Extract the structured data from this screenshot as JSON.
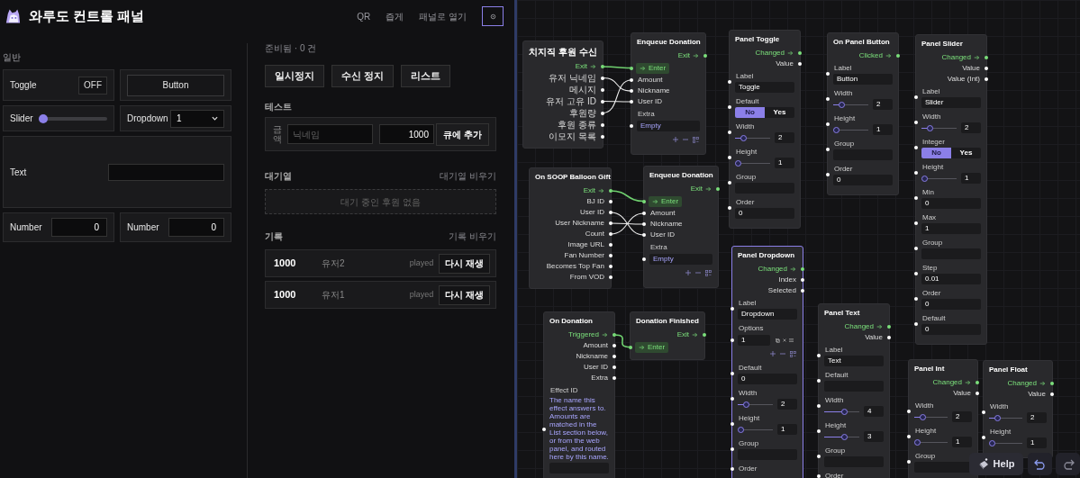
{
  "header": {
    "title": "와루도 컨트롤 패널",
    "links": [
      "QR",
      "즙게",
      "패널로 열기"
    ]
  },
  "panel": {
    "section": "일반",
    "widgets": [
      {
        "kind": "toggle",
        "label": "Toggle",
        "on": false,
        "state_text": "OFF"
      },
      {
        "kind": "button",
        "label": "Button"
      },
      {
        "kind": "slider",
        "label": "Slider",
        "level": 0
      },
      {
        "kind": "dropdown",
        "label": "Dropdown",
        "value": "1"
      },
      {
        "kind": "text",
        "label": "Text"
      },
      {
        "kind": "number",
        "label": "Number",
        "value": "0"
      },
      {
        "kind": "number",
        "label": "Number",
        "value": "0"
      }
    ]
  },
  "queue": {
    "status": "준비됨 · 0 건",
    "buttons": [
      "일시정지",
      "수신 정지",
      "리스트"
    ],
    "test": {
      "heading": "테스트",
      "amount_label": "금액",
      "nickname_placeholder": "닉네임",
      "amount": "1000",
      "add_button": "큐에 추가"
    },
    "waiting": {
      "heading": "대기열",
      "clear": "대기열 비우기",
      "empty": "대기 중인 후원 없음"
    },
    "history": {
      "heading": "기록",
      "clear": "기록 비우기",
      "rows": [
        {
          "amount": "1000",
          "user": "유저2",
          "status": "played",
          "replay": "다시 재생"
        },
        {
          "amount": "1000",
          "user": "유저1",
          "status": "played",
          "replay": "다시 재생"
        }
      ]
    }
  },
  "graph": {
    "nodes": [
      {
        "title": "치지직 후원 수신",
        "selected": false,
        "outputs": [
          {
            "label": "Exit",
            "kind": "flow"
          },
          {
            "label": "유저 닉네임",
            "kind": "data"
          },
          {
            "label": "메시지",
            "kind": "data"
          },
          {
            "label": "유저 고유 ID",
            "kind": "data"
          },
          {
            "label": "후원량",
            "kind": "data"
          },
          {
            "label": "후원 종류",
            "kind": "data"
          },
          {
            "label": "이모지 목록",
            "kind": "data"
          }
        ]
      },
      {
        "title": "Enqueue Donation",
        "selected": false,
        "outputs": [
          {
            "label": "Exit",
            "kind": "flow"
          }
        ],
        "inputs": [
          {
            "label": "Enter",
            "kind": "flow"
          },
          {
            "label": "Amount",
            "kind": "data"
          },
          {
            "label": "Nickname",
            "kind": "data"
          },
          {
            "label": "User ID",
            "kind": "data"
          }
        ],
        "fields": [
          {
            "kind": "list",
            "label": "Extra",
            "empty": "Empty"
          }
        ]
      },
      {
        "title": "Panel Toggle",
        "selected": false,
        "outputs": [
          {
            "label": "Changed",
            "kind": "flow"
          },
          {
            "label": "Value",
            "kind": "data"
          }
        ],
        "fields": [
          {
            "kind": "text",
            "label": "Label",
            "value": "Toggle"
          },
          {
            "kind": "choice",
            "label": "Default",
            "options": [
              {
                "label": "No",
                "selected": true
              },
              {
                "label": "Yes",
                "selected": false
              }
            ]
          },
          {
            "kind": "slider",
            "label": "Width",
            "level": 0.2,
            "value": "2"
          },
          {
            "kind": "slider",
            "label": "Height",
            "level": 0,
            "value": "1"
          },
          {
            "kind": "text",
            "label": "Group"
          },
          {
            "kind": "text",
            "label": "Order",
            "value": "0"
          }
        ]
      },
      {
        "title": "On Panel Button",
        "selected": false,
        "outputs": [
          {
            "label": "Clicked",
            "kind": "flow"
          }
        ],
        "fields": [
          {
            "kind": "text",
            "label": "Label",
            "value": "Button"
          },
          {
            "kind": "slider",
            "label": "Width",
            "level": 0.2,
            "value": "2"
          },
          {
            "kind": "slider",
            "label": "Height",
            "level": 0,
            "value": "1"
          },
          {
            "kind": "text",
            "label": "Group"
          },
          {
            "kind": "text",
            "label": "Order",
            "value": "0"
          }
        ]
      },
      {
        "title": "Panel Slider",
        "selected": false,
        "outputs": [
          {
            "label": "Changed",
            "kind": "flow"
          },
          {
            "label": "Value",
            "kind": "data"
          },
          {
            "label": "Value (Int)",
            "kind": "data"
          }
        ],
        "fields": [
          {
            "kind": "text",
            "label": "Label",
            "value": "Slider"
          },
          {
            "kind": "slider",
            "label": "Width",
            "level": 0.2,
            "value": "2"
          },
          {
            "kind": "choice",
            "label": "Integer",
            "options": [
              {
                "label": "No",
                "selected": true
              },
              {
                "label": "Yes",
                "selected": false
              }
            ]
          },
          {
            "kind": "slider",
            "label": "Height",
            "level": 0,
            "value": "1"
          },
          {
            "kind": "text",
            "label": "Min",
            "value": "0"
          },
          {
            "kind": "text",
            "label": "Max",
            "value": "1"
          },
          {
            "kind": "text",
            "label": "Group"
          },
          {
            "kind": "text",
            "label": "Step",
            "value": "0.01"
          },
          {
            "kind": "text",
            "label": "Order",
            "value": "0"
          },
          {
            "kind": "text",
            "label": "Default",
            "value": "0"
          }
        ]
      },
      {
        "title": "On SOOP Balloon Gift",
        "selected": false,
        "outputs": [
          {
            "label": "Exit",
            "kind": "flow"
          },
          {
            "label": "BJ ID",
            "kind": "data"
          },
          {
            "label": "User ID",
            "kind": "data"
          },
          {
            "label": "User Nickname",
            "kind": "data"
          },
          {
            "label": "Count",
            "kind": "data"
          },
          {
            "label": "Image URL",
            "kind": "data"
          },
          {
            "label": "Fan Number",
            "kind": "data"
          },
          {
            "label": "Becomes Top Fan",
            "kind": "data"
          },
          {
            "label": "From VOD",
            "kind": "data"
          }
        ]
      },
      {
        "title": "Enqueue Donation",
        "selected": false,
        "outputs": [
          {
            "label": "Exit",
            "kind": "flow"
          }
        ],
        "inputs": [
          {
            "label": "Enter",
            "kind": "flow"
          },
          {
            "label": "Amount",
            "kind": "data"
          },
          {
            "label": "Nickname",
            "kind": "data"
          },
          {
            "label": "User ID",
            "kind": "data"
          }
        ],
        "fields": [
          {
            "kind": "list",
            "label": "Extra",
            "empty": "Empty"
          }
        ]
      },
      {
        "title": "Panel Dropdown",
        "selected": true,
        "outputs": [
          {
            "label": "Changed",
            "kind": "flow"
          },
          {
            "label": "Index",
            "kind": "data"
          },
          {
            "label": "Selected",
            "kind": "data"
          }
        ],
        "fields": [
          {
            "kind": "text",
            "label": "Label",
            "value": "Dropdown"
          },
          {
            "kind": "list",
            "label": "Options",
            "items": [
              "1"
            ]
          },
          {
            "kind": "text",
            "label": "Default",
            "value": "0"
          },
          {
            "kind": "slider",
            "label": "Width",
            "level": 0.2,
            "value": "2"
          },
          {
            "kind": "slider",
            "label": "Height",
            "level": 0,
            "value": "1"
          },
          {
            "kind": "text",
            "label": "Group"
          },
          {
            "kind": "label",
            "label": "Order"
          }
        ]
      },
      {
        "title": "On Donation",
        "selected": false,
        "outputs": [
          {
            "label": "Triggered",
            "kind": "flow"
          },
          {
            "label": "Amount",
            "kind": "data"
          },
          {
            "label": "Nickname",
            "kind": "data"
          },
          {
            "label": "User ID",
            "kind": "data"
          },
          {
            "label": "Extra",
            "kind": "data"
          }
        ],
        "fields": [
          {
            "kind": "text",
            "label": "Effect ID",
            "note": "The name this effect answers to. Amounts are matched in the List section below, or from the web panel, and routed here by this name."
          }
        ]
      },
      {
        "title": "Donation Finished",
        "selected": false,
        "outputs": [
          {
            "label": "Exit",
            "kind": "flow"
          }
        ],
        "inputs": [
          {
            "label": "Enter",
            "kind": "flow"
          }
        ]
      },
      {
        "title": "Panel Text",
        "selected": false,
        "outputs": [
          {
            "label": "Changed",
            "kind": "flow"
          },
          {
            "label": "Value",
            "kind": "data"
          }
        ],
        "fields": [
          {
            "kind": "text",
            "label": "Label",
            "value": "Text"
          },
          {
            "kind": "text",
            "label": "Default"
          },
          {
            "kind": "slider",
            "label": "Width",
            "level": 0.6,
            "value": "4"
          },
          {
            "kind": "slider",
            "label": "Height",
            "level": 0.6,
            "value": "3"
          },
          {
            "kind": "text",
            "label": "Group"
          },
          {
            "kind": "label",
            "label": "Order"
          }
        ]
      },
      {
        "title": "Panel Int",
        "selected": false,
        "outputs": [
          {
            "label": "Changed",
            "kind": "flow"
          },
          {
            "label": "Value",
            "kind": "data"
          }
        ],
        "fields": [
          {
            "kind": "slider",
            "label": "Width",
            "level": 0.2,
            "value": "2"
          },
          {
            "kind": "slider",
            "label": "Height",
            "level": 0,
            "value": "1"
          },
          {
            "kind": "text",
            "label": "Group"
          }
        ]
      },
      {
        "title": "Panel Float",
        "selected": false,
        "outputs": [
          {
            "label": "Changed",
            "kind": "flow"
          },
          {
            "label": "Value",
            "kind": "data"
          }
        ],
        "fields": [
          {
            "kind": "slider",
            "label": "Width",
            "level": 0.2,
            "value": "2"
          },
          {
            "kind": "slider",
            "label": "Height",
            "level": 0,
            "value": "1"
          }
        ]
      }
    ],
    "help": "Help"
  }
}
